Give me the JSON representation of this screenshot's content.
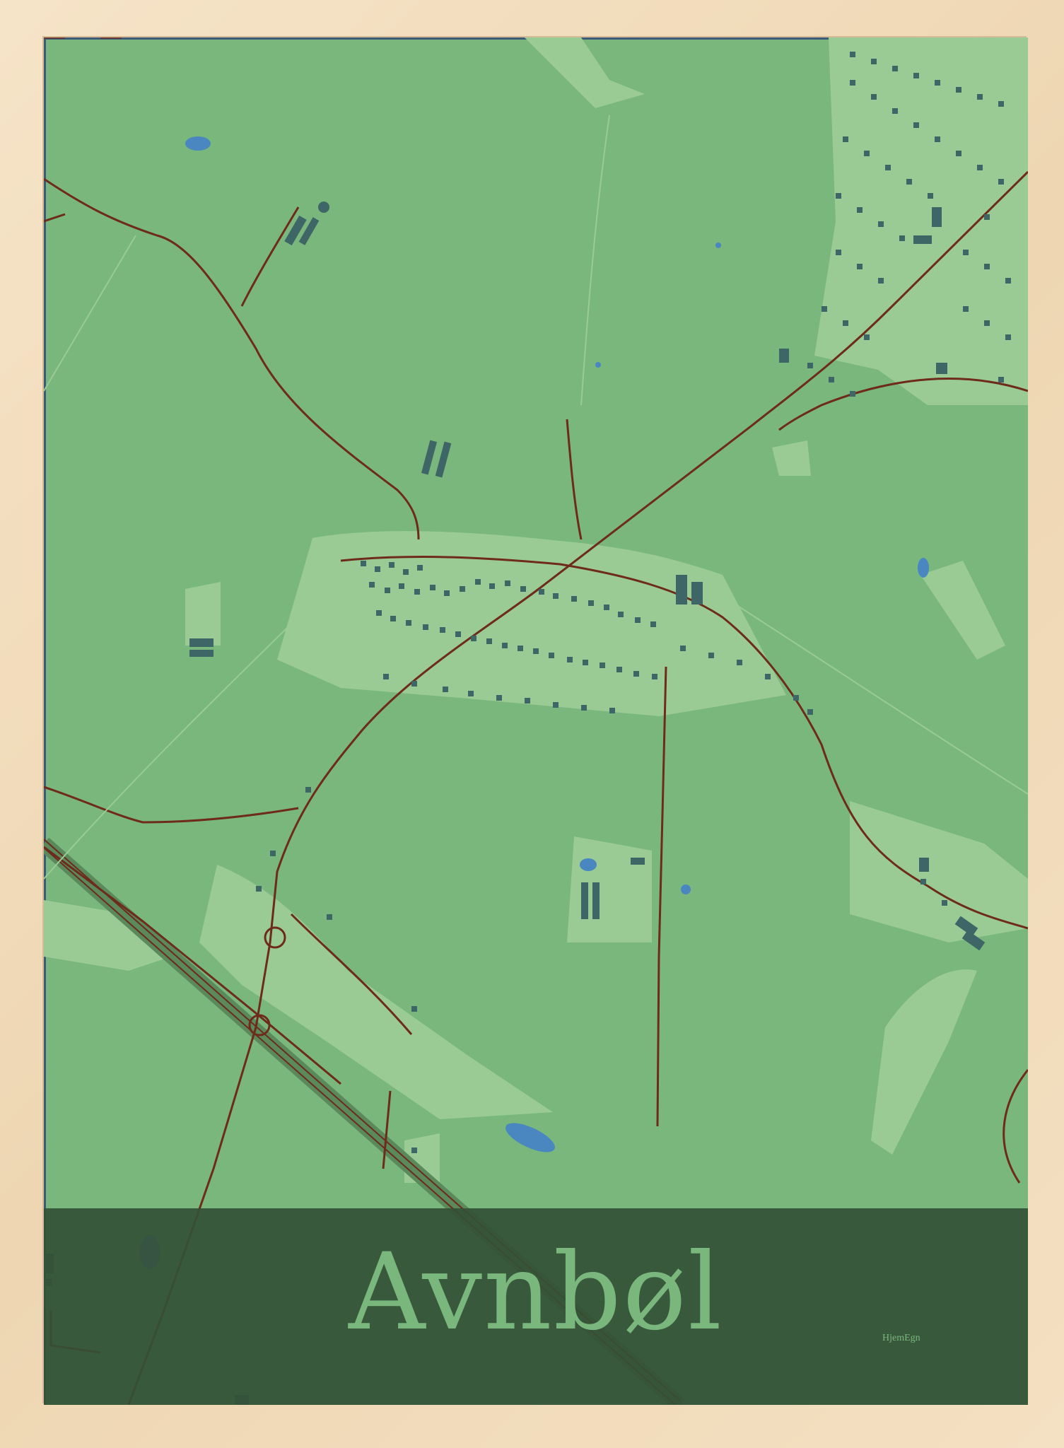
{
  "poster": {
    "title": "Avnbøl",
    "brand": "HjemEgn"
  },
  "colors": {
    "frame": "#f3dfc1",
    "fields": "#79b77c",
    "urban": "#9acb95",
    "roads": "#6e2a1a",
    "buildings": "#3f6667",
    "water": "#4a86c0",
    "banner": "#345036",
    "title": "#79b77c"
  }
}
